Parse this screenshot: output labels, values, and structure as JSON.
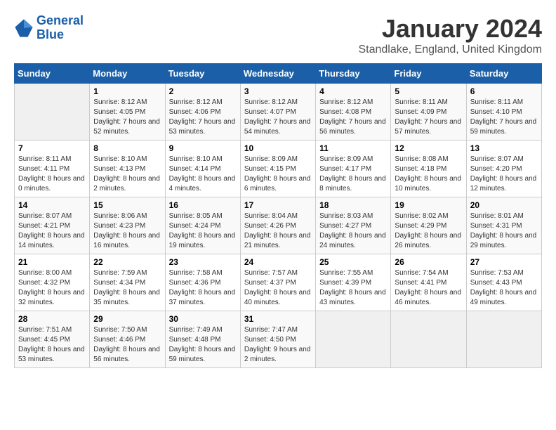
{
  "logo": {
    "line1": "General",
    "line2": "Blue"
  },
  "title": "January 2024",
  "location": "Standlake, England, United Kingdom",
  "days_of_week": [
    "Sunday",
    "Monday",
    "Tuesday",
    "Wednesday",
    "Thursday",
    "Friday",
    "Saturday"
  ],
  "weeks": [
    [
      {
        "day": "",
        "sunrise": "",
        "sunset": "",
        "daylight": ""
      },
      {
        "day": "1",
        "sunrise": "Sunrise: 8:12 AM",
        "sunset": "Sunset: 4:05 PM",
        "daylight": "Daylight: 7 hours and 52 minutes."
      },
      {
        "day": "2",
        "sunrise": "Sunrise: 8:12 AM",
        "sunset": "Sunset: 4:06 PM",
        "daylight": "Daylight: 7 hours and 53 minutes."
      },
      {
        "day": "3",
        "sunrise": "Sunrise: 8:12 AM",
        "sunset": "Sunset: 4:07 PM",
        "daylight": "Daylight: 7 hours and 54 minutes."
      },
      {
        "day": "4",
        "sunrise": "Sunrise: 8:12 AM",
        "sunset": "Sunset: 4:08 PM",
        "daylight": "Daylight: 7 hours and 56 minutes."
      },
      {
        "day": "5",
        "sunrise": "Sunrise: 8:11 AM",
        "sunset": "Sunset: 4:09 PM",
        "daylight": "Daylight: 7 hours and 57 minutes."
      },
      {
        "day": "6",
        "sunrise": "Sunrise: 8:11 AM",
        "sunset": "Sunset: 4:10 PM",
        "daylight": "Daylight: 7 hours and 59 minutes."
      }
    ],
    [
      {
        "day": "7",
        "sunrise": "Sunrise: 8:11 AM",
        "sunset": "Sunset: 4:11 PM",
        "daylight": "Daylight: 8 hours and 0 minutes."
      },
      {
        "day": "8",
        "sunrise": "Sunrise: 8:10 AM",
        "sunset": "Sunset: 4:13 PM",
        "daylight": "Daylight: 8 hours and 2 minutes."
      },
      {
        "day": "9",
        "sunrise": "Sunrise: 8:10 AM",
        "sunset": "Sunset: 4:14 PM",
        "daylight": "Daylight: 8 hours and 4 minutes."
      },
      {
        "day": "10",
        "sunrise": "Sunrise: 8:09 AM",
        "sunset": "Sunset: 4:15 PM",
        "daylight": "Daylight: 8 hours and 6 minutes."
      },
      {
        "day": "11",
        "sunrise": "Sunrise: 8:09 AM",
        "sunset": "Sunset: 4:17 PM",
        "daylight": "Daylight: 8 hours and 8 minutes."
      },
      {
        "day": "12",
        "sunrise": "Sunrise: 8:08 AM",
        "sunset": "Sunset: 4:18 PM",
        "daylight": "Daylight: 8 hours and 10 minutes."
      },
      {
        "day": "13",
        "sunrise": "Sunrise: 8:07 AM",
        "sunset": "Sunset: 4:20 PM",
        "daylight": "Daylight: 8 hours and 12 minutes."
      }
    ],
    [
      {
        "day": "14",
        "sunrise": "Sunrise: 8:07 AM",
        "sunset": "Sunset: 4:21 PM",
        "daylight": "Daylight: 8 hours and 14 minutes."
      },
      {
        "day": "15",
        "sunrise": "Sunrise: 8:06 AM",
        "sunset": "Sunset: 4:23 PM",
        "daylight": "Daylight: 8 hours and 16 minutes."
      },
      {
        "day": "16",
        "sunrise": "Sunrise: 8:05 AM",
        "sunset": "Sunset: 4:24 PM",
        "daylight": "Daylight: 8 hours and 19 minutes."
      },
      {
        "day": "17",
        "sunrise": "Sunrise: 8:04 AM",
        "sunset": "Sunset: 4:26 PM",
        "daylight": "Daylight: 8 hours and 21 minutes."
      },
      {
        "day": "18",
        "sunrise": "Sunrise: 8:03 AM",
        "sunset": "Sunset: 4:27 PM",
        "daylight": "Daylight: 8 hours and 24 minutes."
      },
      {
        "day": "19",
        "sunrise": "Sunrise: 8:02 AM",
        "sunset": "Sunset: 4:29 PM",
        "daylight": "Daylight: 8 hours and 26 minutes."
      },
      {
        "day": "20",
        "sunrise": "Sunrise: 8:01 AM",
        "sunset": "Sunset: 4:31 PM",
        "daylight": "Daylight: 8 hours and 29 minutes."
      }
    ],
    [
      {
        "day": "21",
        "sunrise": "Sunrise: 8:00 AM",
        "sunset": "Sunset: 4:32 PM",
        "daylight": "Daylight: 8 hours and 32 minutes."
      },
      {
        "day": "22",
        "sunrise": "Sunrise: 7:59 AM",
        "sunset": "Sunset: 4:34 PM",
        "daylight": "Daylight: 8 hours and 35 minutes."
      },
      {
        "day": "23",
        "sunrise": "Sunrise: 7:58 AM",
        "sunset": "Sunset: 4:36 PM",
        "daylight": "Daylight: 8 hours and 37 minutes."
      },
      {
        "day": "24",
        "sunrise": "Sunrise: 7:57 AM",
        "sunset": "Sunset: 4:37 PM",
        "daylight": "Daylight: 8 hours and 40 minutes."
      },
      {
        "day": "25",
        "sunrise": "Sunrise: 7:55 AM",
        "sunset": "Sunset: 4:39 PM",
        "daylight": "Daylight: 8 hours and 43 minutes."
      },
      {
        "day": "26",
        "sunrise": "Sunrise: 7:54 AM",
        "sunset": "Sunset: 4:41 PM",
        "daylight": "Daylight: 8 hours and 46 minutes."
      },
      {
        "day": "27",
        "sunrise": "Sunrise: 7:53 AM",
        "sunset": "Sunset: 4:43 PM",
        "daylight": "Daylight: 8 hours and 49 minutes."
      }
    ],
    [
      {
        "day": "28",
        "sunrise": "Sunrise: 7:51 AM",
        "sunset": "Sunset: 4:45 PM",
        "daylight": "Daylight: 8 hours and 53 minutes."
      },
      {
        "day": "29",
        "sunrise": "Sunrise: 7:50 AM",
        "sunset": "Sunset: 4:46 PM",
        "daylight": "Daylight: 8 hours and 56 minutes."
      },
      {
        "day": "30",
        "sunrise": "Sunrise: 7:49 AM",
        "sunset": "Sunset: 4:48 PM",
        "daylight": "Daylight: 8 hours and 59 minutes."
      },
      {
        "day": "31",
        "sunrise": "Sunrise: 7:47 AM",
        "sunset": "Sunset: 4:50 PM",
        "daylight": "Daylight: 9 hours and 2 minutes."
      },
      {
        "day": "",
        "sunrise": "",
        "sunset": "",
        "daylight": ""
      },
      {
        "day": "",
        "sunrise": "",
        "sunset": "",
        "daylight": ""
      },
      {
        "day": "",
        "sunrise": "",
        "sunset": "",
        "daylight": ""
      }
    ]
  ]
}
